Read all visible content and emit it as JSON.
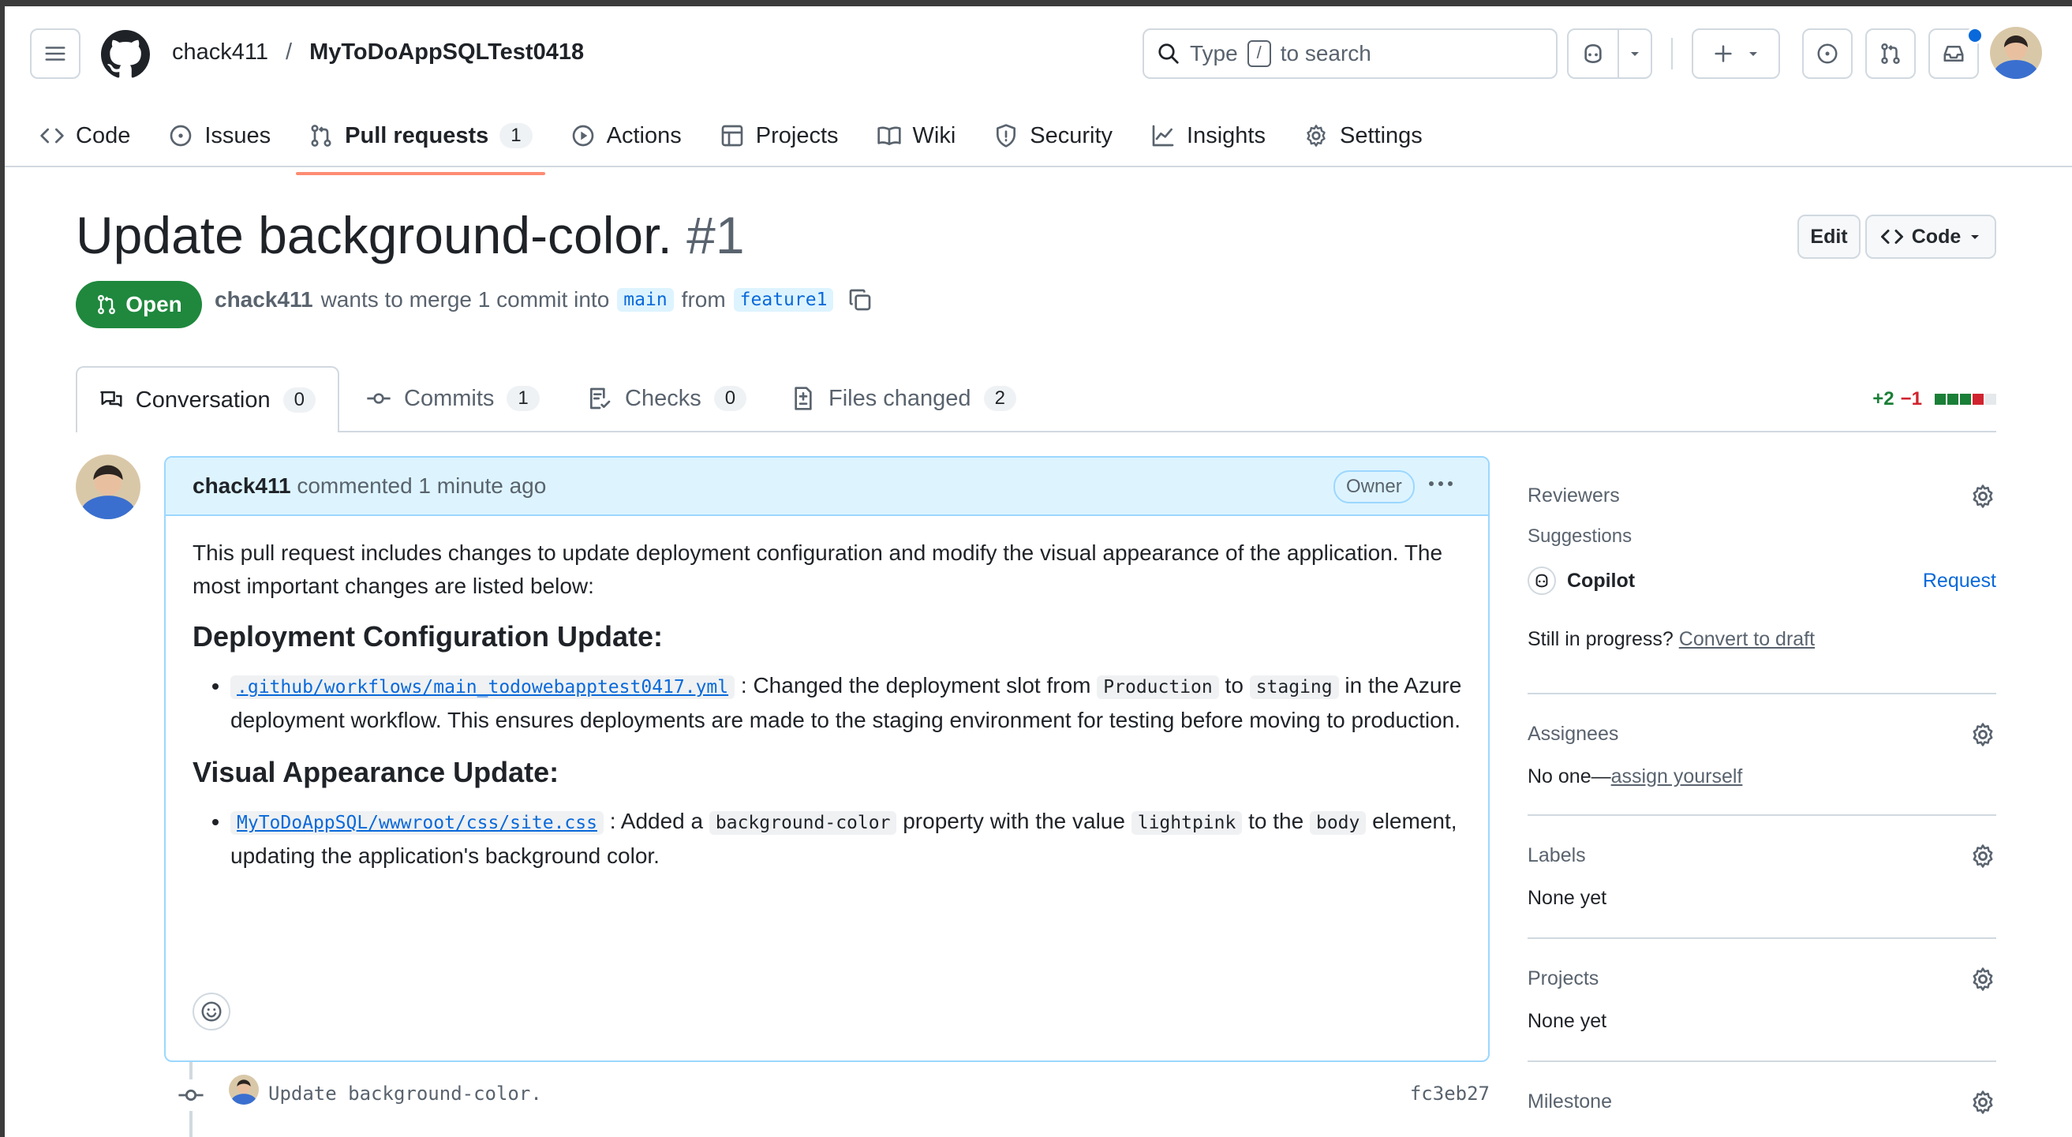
{
  "header": {
    "owner": "chack411",
    "separator": "/",
    "repo": "MyToDoAppSQLTest0418",
    "search_type": "Type",
    "search_key": "/",
    "search_rest": "to search"
  },
  "repo_nav": [
    {
      "label": "Code"
    },
    {
      "label": "Issues"
    },
    {
      "label": "Pull requests",
      "count": "1"
    },
    {
      "label": "Actions"
    },
    {
      "label": "Projects"
    },
    {
      "label": "Wiki"
    },
    {
      "label": "Security"
    },
    {
      "label": "Insights"
    },
    {
      "label": "Settings"
    }
  ],
  "pr": {
    "title": "Update background-color.",
    "number": "#1",
    "edit_label": "Edit",
    "code_label": "Code",
    "state": "Open",
    "author": "chack411",
    "merge_text": "wants to merge 1 commit into",
    "base": "main",
    "from_text": "from",
    "head": "feature1"
  },
  "tabs": [
    {
      "label": "Conversation",
      "count": "0"
    },
    {
      "label": "Commits",
      "count": "1"
    },
    {
      "label": "Checks",
      "count": "0"
    },
    {
      "label": "Files changed",
      "count": "2"
    }
  ],
  "diffstat": {
    "added": "+2",
    "removed": "−1",
    "blocks": [
      "green",
      "green",
      "green",
      "red",
      "gray"
    ]
  },
  "comment": {
    "author": "chack411",
    "action": "commented 1 minute ago",
    "badge": "Owner",
    "intro": "This pull request includes changes to update deployment configuration and modify the visual appearance of the application. The most important changes are listed below:",
    "h1": "Deployment Configuration Update:",
    "item1_file": ".github/workflows/main_todowebapptest0417.yml",
    "item1_a": ": Changed the deployment slot from",
    "item1_code1": "Production",
    "item1_b": "to",
    "item1_code2": "staging",
    "item1_c": "in the Azure deployment workflow. This ensures deployments are made to the staging environment for testing before moving to production.",
    "h2": "Visual Appearance Update:",
    "item2_file": "MyToDoAppSQL/wwwroot/css/site.css",
    "item2_a": ": Added a",
    "item2_code1": "background-color",
    "item2_b": "property with the value",
    "item2_code2": "lightpink",
    "item2_c": "to the",
    "item2_code3": "body",
    "item2_d": "element, updating the application's background color."
  },
  "timeline": {
    "commit_message": "Update background-color.",
    "sha": "fc3eb27"
  },
  "sidebar": {
    "reviewers": {
      "title": "Reviewers",
      "suggestions": "Suggestions",
      "copilot": "Copilot",
      "request": "Request",
      "progress": "Still in progress?",
      "draft": "Convert to draft"
    },
    "assignees": {
      "title": "Assignees",
      "prefix": "No one—",
      "assign": "assign yourself"
    },
    "labels": {
      "title": "Labels",
      "value": "None yet"
    },
    "projects": {
      "title": "Projects",
      "value": "None yet"
    },
    "milestone": {
      "title": "Milestone"
    }
  },
  "colors": {
    "accent": "#0969da",
    "open_green": "#1f883d",
    "tab_underline": "#fd8c73",
    "highlight_bg": "#ddf4ff"
  }
}
